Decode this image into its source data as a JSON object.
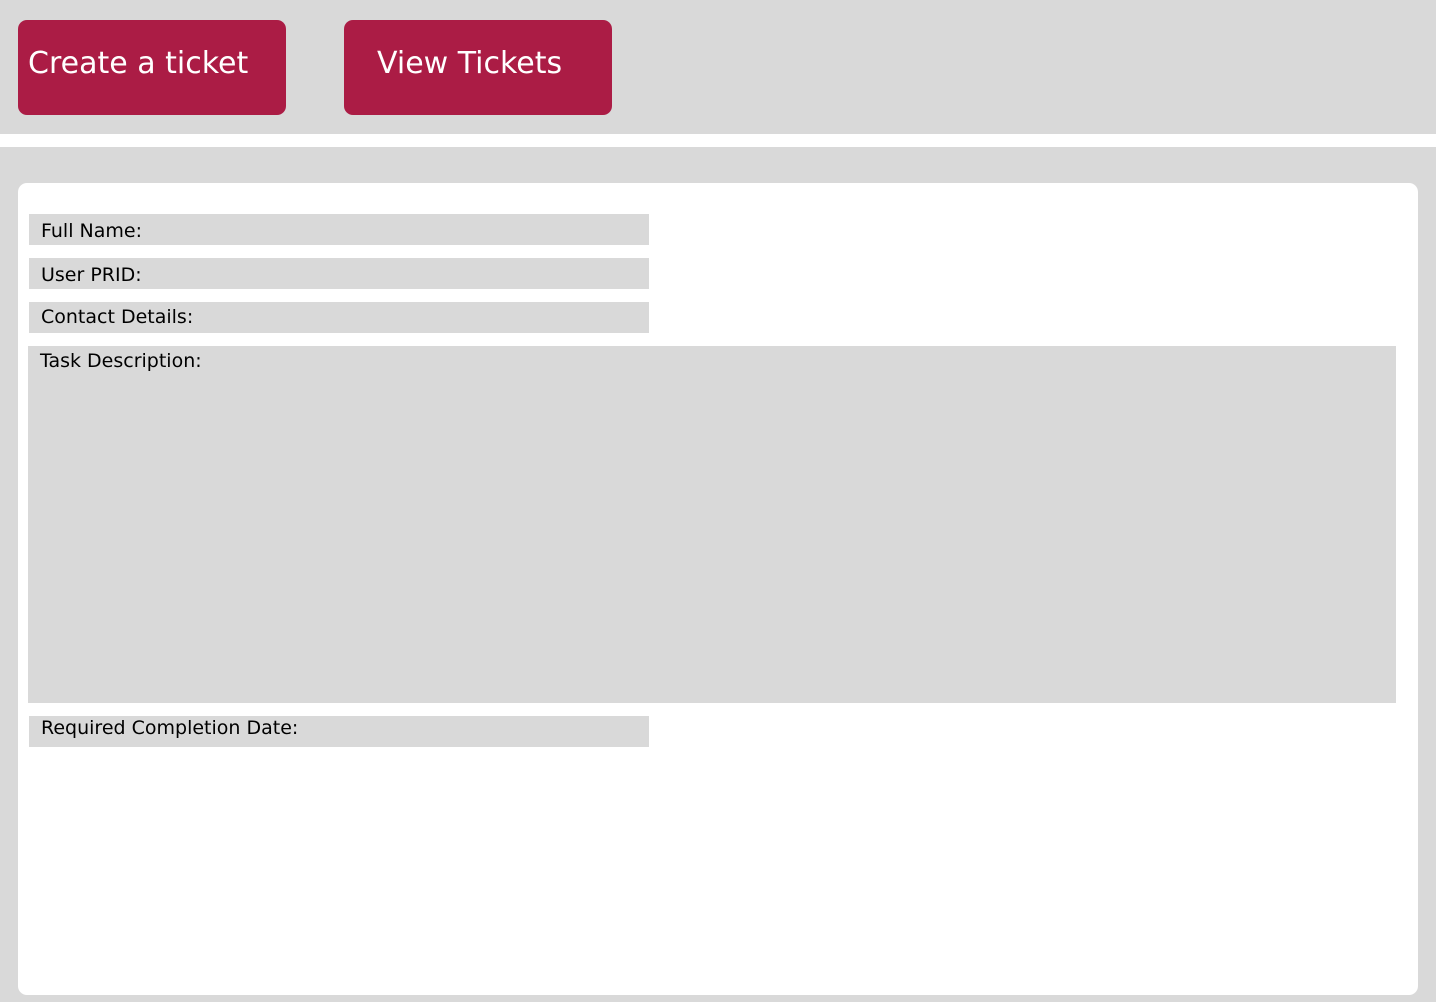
{
  "nav": {
    "create_label": "Create a ticket",
    "view_label": "View Tickets"
  },
  "form": {
    "full_name_label": "Full Name:",
    "user_prid_label": "User PRID:",
    "contact_details_label": "Contact Details:",
    "task_description_label": "Task Description:",
    "required_completion_date_label": "Required Completion Date:"
  },
  "colors": {
    "accent": "#ab1c45",
    "panel_background": "#d9d9d9",
    "card_background": "#ffffff"
  }
}
